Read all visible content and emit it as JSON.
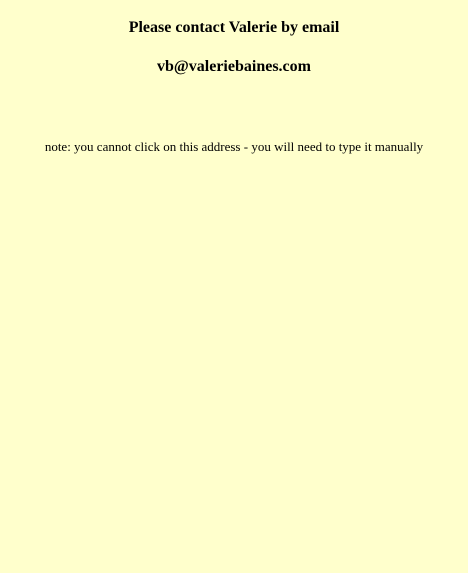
{
  "contact": {
    "heading": "Please contact Valerie by email",
    "email": "vb@valeriebaines.com",
    "note": "note: you cannot click on this address - you will need to type it manually"
  },
  "colors": {
    "background": "#ffffcc",
    "text": "#000000"
  }
}
